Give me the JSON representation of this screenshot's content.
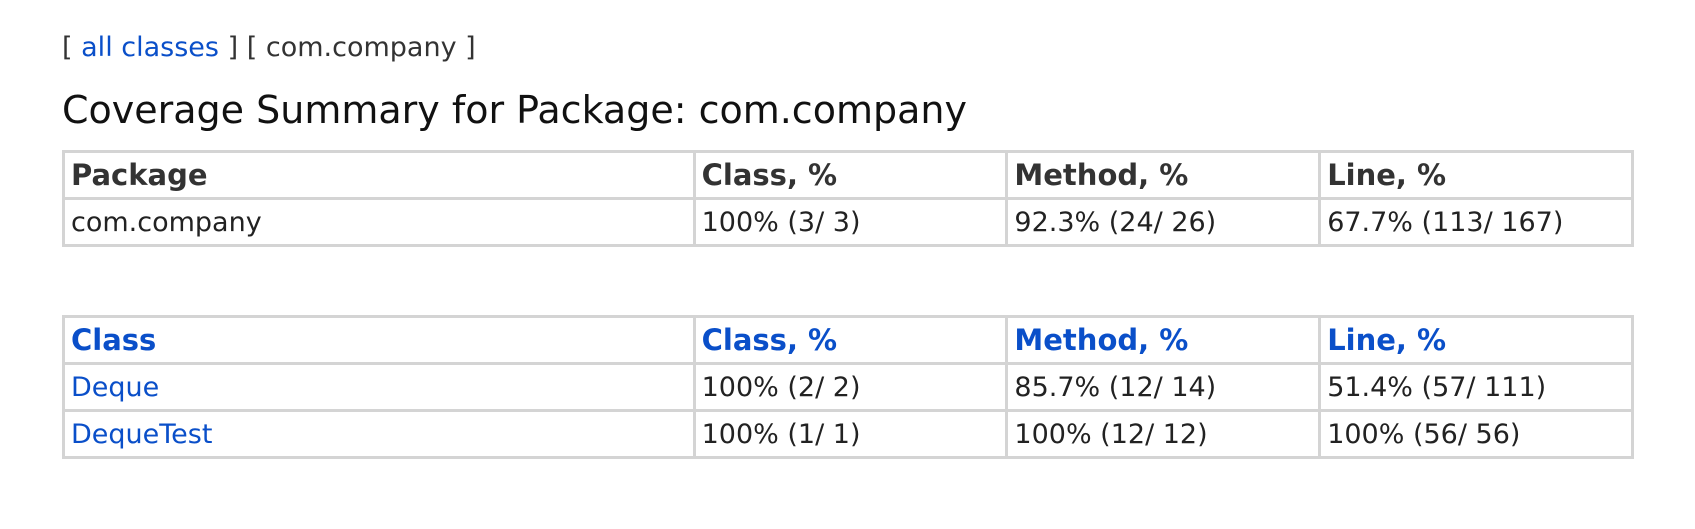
{
  "breadcrumb": {
    "open1": "[",
    "all_classes": "all classes",
    "close1": "]",
    "open2": "[",
    "package": "com.company",
    "close2": "]"
  },
  "title": "Coverage Summary for Package: com.company",
  "package_table": {
    "headers": [
      "Package",
      "Class, %",
      "Method, %",
      "Line, %"
    ],
    "rows": [
      [
        "com.company",
        "100% (3/ 3)",
        "92.3% (24/ 26)",
        "67.7% (113/ 167)"
      ]
    ]
  },
  "class_table": {
    "headers": [
      "Class",
      "Class, %",
      "Method, %",
      "Line, %"
    ],
    "rows": [
      [
        "Deque",
        "100% (2/ 2)",
        "85.7% (12/ 14)",
        "51.4% (57/ 111)"
      ],
      [
        "DequeTest",
        "100% (1/ 1)",
        "100% (12/ 12)",
        "100% (56/ 56)"
      ]
    ]
  },
  "colors": {
    "link": "#0a4fc9",
    "border": "#d4d4d4"
  }
}
